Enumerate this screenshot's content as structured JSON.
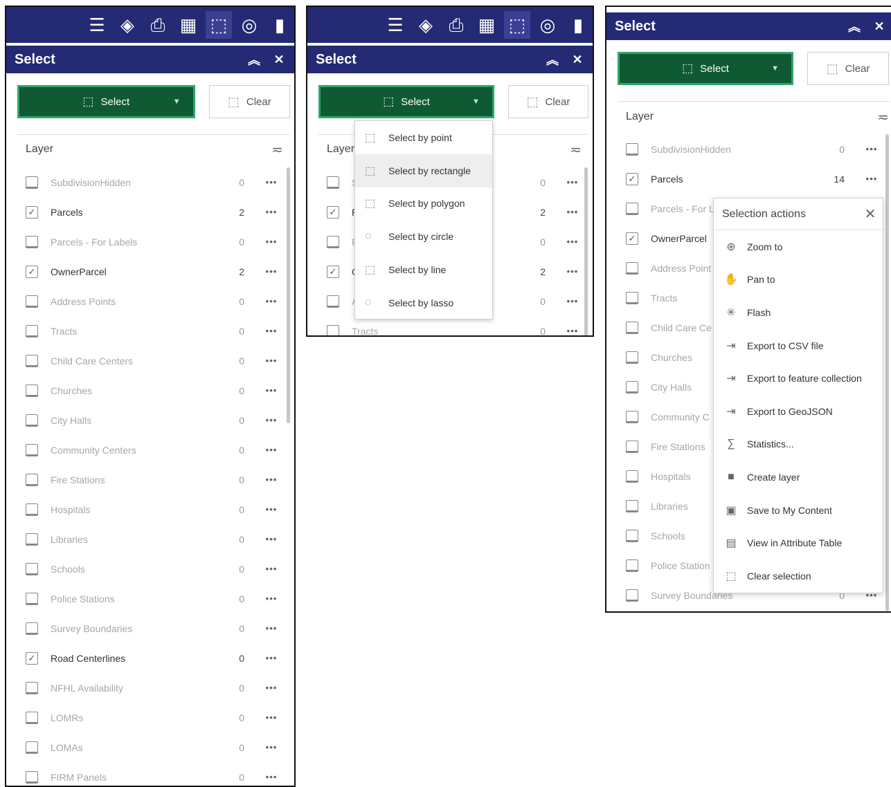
{
  "toolbar_icons": [
    "list-icon",
    "layers-icon",
    "print-icon",
    "grid-icon",
    "select-tool-icon",
    "compass-icon",
    "add-data-icon"
  ],
  "panels": {
    "p1": {
      "title": "Select",
      "select_label": "Select",
      "clear_label": "Clear",
      "layer_header": "Layer",
      "layers": [
        {
          "name": "SubdivisionHidden",
          "count": "0",
          "checked": false
        },
        {
          "name": "Parcels",
          "count": "2",
          "checked": true
        },
        {
          "name": "Parcels - For Labels",
          "count": "0",
          "checked": false
        },
        {
          "name": "OwnerParcel",
          "count": "2",
          "checked": true
        },
        {
          "name": "Address Points",
          "count": "0",
          "checked": false
        },
        {
          "name": "Tracts",
          "count": "0",
          "checked": false
        },
        {
          "name": "Child Care Centers",
          "count": "0",
          "checked": false
        },
        {
          "name": "Churches",
          "count": "0",
          "checked": false
        },
        {
          "name": "City Halls",
          "count": "0",
          "checked": false
        },
        {
          "name": "Community Centers",
          "count": "0",
          "checked": false
        },
        {
          "name": "Fire Stations",
          "count": "0",
          "checked": false
        },
        {
          "name": "Hospitals",
          "count": "0",
          "checked": false
        },
        {
          "name": "Libraries",
          "count": "0",
          "checked": false
        },
        {
          "name": "Schools",
          "count": "0",
          "checked": false
        },
        {
          "name": "Police Stations",
          "count": "0",
          "checked": false
        },
        {
          "name": "Survey Boundaries",
          "count": "0",
          "checked": false
        },
        {
          "name": "Road Centerlines",
          "count": "0",
          "checked": true
        },
        {
          "name": "NFHL Availability",
          "count": "0",
          "checked": false
        },
        {
          "name": "LOMRs",
          "count": "0",
          "checked": false
        },
        {
          "name": "LOMAs",
          "count": "0",
          "checked": false
        },
        {
          "name": "FIRM Panels",
          "count": "0",
          "checked": false
        }
      ]
    },
    "p2": {
      "title": "Select",
      "select_label": "Select",
      "clear_label": "Clear",
      "layer_header": "Layer",
      "layers": [
        {
          "name": "S",
          "count": "0",
          "checked": false
        },
        {
          "name": "P",
          "count": "2",
          "checked": true
        },
        {
          "name": "P",
          "count": "0",
          "checked": false
        },
        {
          "name": "O",
          "count": "2",
          "checked": true
        },
        {
          "name": "A",
          "count": "0",
          "checked": false
        },
        {
          "name": "Tracts",
          "count": "0",
          "checked": false
        }
      ],
      "dropdown": [
        {
          "label": "Select by point",
          "icon": "select-point-icon"
        },
        {
          "label": "Select by rectangle",
          "icon": "select-rectangle-icon"
        },
        {
          "label": "Select by polygon",
          "icon": "select-polygon-icon"
        },
        {
          "label": "Select by circle",
          "icon": "select-circle-icon"
        },
        {
          "label": "Select by line",
          "icon": "select-line-icon"
        },
        {
          "label": "Select by lasso",
          "icon": "select-lasso-icon"
        }
      ]
    },
    "p3": {
      "title": "Select",
      "select_label": "Select",
      "clear_label": "Clear",
      "layer_header": "Layer",
      "layers": [
        {
          "name": "SubdivisionHidden",
          "count": "0",
          "checked": false
        },
        {
          "name": "Parcels",
          "count": "14",
          "checked": true
        },
        {
          "name": "Parcels - For L",
          "count": "",
          "checked": false
        },
        {
          "name": "OwnerParcel",
          "count": "",
          "checked": true
        },
        {
          "name": "Address Point",
          "count": "",
          "checked": false
        },
        {
          "name": "Tracts",
          "count": "",
          "checked": false
        },
        {
          "name": "Child Care Ce",
          "count": "",
          "checked": false
        },
        {
          "name": "Churches",
          "count": "",
          "checked": false
        },
        {
          "name": "City Halls",
          "count": "",
          "checked": false
        },
        {
          "name": "Community C",
          "count": "",
          "checked": false
        },
        {
          "name": "Fire Stations",
          "count": "",
          "checked": false
        },
        {
          "name": "Hospitals",
          "count": "",
          "checked": false
        },
        {
          "name": "Libraries",
          "count": "",
          "checked": false
        },
        {
          "name": "Schools",
          "count": "",
          "checked": false
        },
        {
          "name": "Police Station",
          "count": "",
          "checked": false
        },
        {
          "name": "Survey Boundaries",
          "count": "0",
          "checked": false
        }
      ],
      "actions_title": "Selection actions",
      "actions": [
        {
          "label": "Zoom to",
          "icon": "zoom-to-icon"
        },
        {
          "label": "Pan to",
          "icon": "pan-to-icon"
        },
        {
          "label": "Flash",
          "icon": "flash-icon"
        },
        {
          "label": "Export to CSV file",
          "icon": "export-icon"
        },
        {
          "label": "Export to feature collection",
          "icon": "export-icon"
        },
        {
          "label": "Export to GeoJSON",
          "icon": "export-icon"
        },
        {
          "label": "Statistics...",
          "icon": "statistics-icon"
        },
        {
          "label": "Create layer",
          "icon": "create-layer-icon"
        },
        {
          "label": "Save to My Content",
          "icon": "save-icon"
        },
        {
          "label": "View in Attribute Table",
          "icon": "table-icon"
        },
        {
          "label": "Clear selection",
          "icon": "clear-selection-icon"
        }
      ]
    }
  },
  "colors": {
    "header": "#242a74",
    "select_button": "#105a33",
    "select_border": "#2ea66a"
  }
}
